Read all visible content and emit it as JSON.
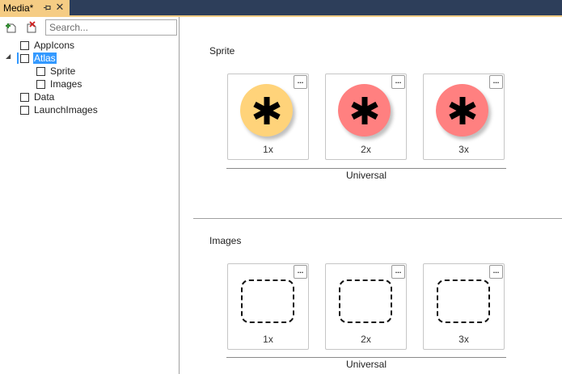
{
  "tab": {
    "title": "Media*",
    "pin_glyph": "ⱼ",
    "close_glyph": "✕"
  },
  "search": {
    "placeholder": "Search..."
  },
  "tree": [
    {
      "label": "AppIcons"
    },
    {
      "label": "Atlas"
    },
    {
      "label": "Sprite"
    },
    {
      "label": "Images"
    },
    {
      "label": "Data"
    },
    {
      "label": "LaunchImages"
    }
  ],
  "sections": {
    "sprite": {
      "title": "Sprite",
      "slots": [
        {
          "label": "1x",
          "color": "#ffd37a"
        },
        {
          "label": "2x",
          "color": "#ff8080"
        },
        {
          "label": "3x",
          "color": "#ff8080"
        }
      ],
      "group_label": "Universal"
    },
    "images": {
      "title": "Images",
      "slots": [
        {
          "label": "1x"
        },
        {
          "label": "2x"
        },
        {
          "label": "3x"
        }
      ],
      "group_label": "Universal"
    }
  },
  "slot_menu_label": "...",
  "expand_glyph": "◢",
  "icons": {
    "add": "add-item-icon",
    "remove": "remove-item-icon",
    "pin": "pin-icon",
    "close": "close-icon",
    "asterisk": "asterisk-icon"
  },
  "colors": {
    "tab_accent": "#f5cc84",
    "titlebar": "#2d3e5a",
    "selection": "#3399ff"
  }
}
